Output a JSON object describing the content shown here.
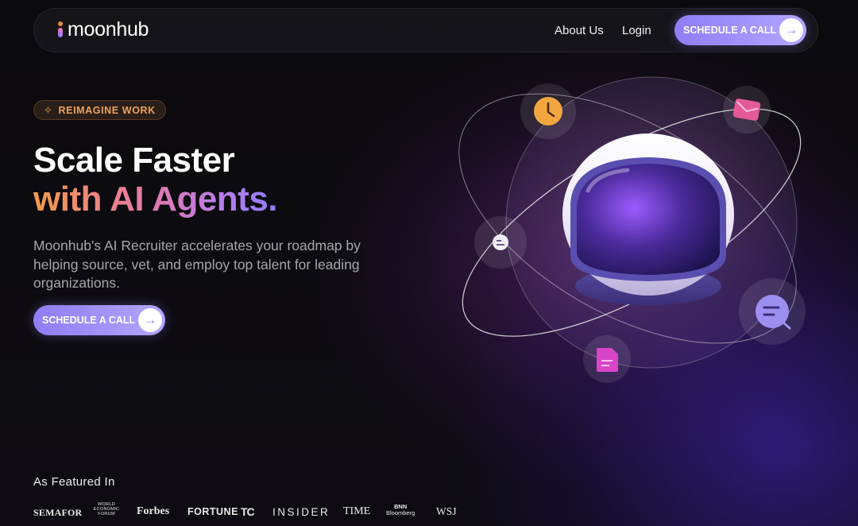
{
  "nav": {
    "logo_text": "moonhub",
    "about_label": "About Us",
    "login_label": "Login",
    "cta_label": "SCHEDULE A CALL",
    "cta_icon": "arrow-right-icon"
  },
  "hero": {
    "badge_label": "REIMAGINE WORK",
    "badge_icon": "sparkle-icon",
    "title_line1": "Scale Faster",
    "title_line2": "with AI Agents.",
    "description": "Moonhub's AI Recruiter accelerates your roadmap by helping source, vet, and employ top talent for leading organizations.",
    "cta_label": "SCHEDULE A CALL",
    "cta_icon": "arrow-right-icon"
  },
  "illustration": {
    "main": "astronaut-helmet",
    "orbit_icons": [
      "clock-icon",
      "mail-icon",
      "chat-bubble-icon",
      "search-document-icon",
      "document-icon"
    ]
  },
  "featured": {
    "title": "As Featured In",
    "logos": {
      "semafor": "SEMAFOR",
      "wef_line1": "WORLD",
      "wef_line2": "ECONOMIC",
      "wef_line3": "FORUM",
      "forbes": "Forbes",
      "fortune": "FORTUNE",
      "techcrunch": "TC",
      "insider": "INSIDER",
      "time": "TIME",
      "bnn_line1": "BNN",
      "bnn_line2": "Bloomberg",
      "wsj": "WSJ"
    }
  },
  "colors": {
    "accent": "#8f7df7",
    "badge_text": "#f0a25a",
    "background": "#0b0a0d"
  }
}
